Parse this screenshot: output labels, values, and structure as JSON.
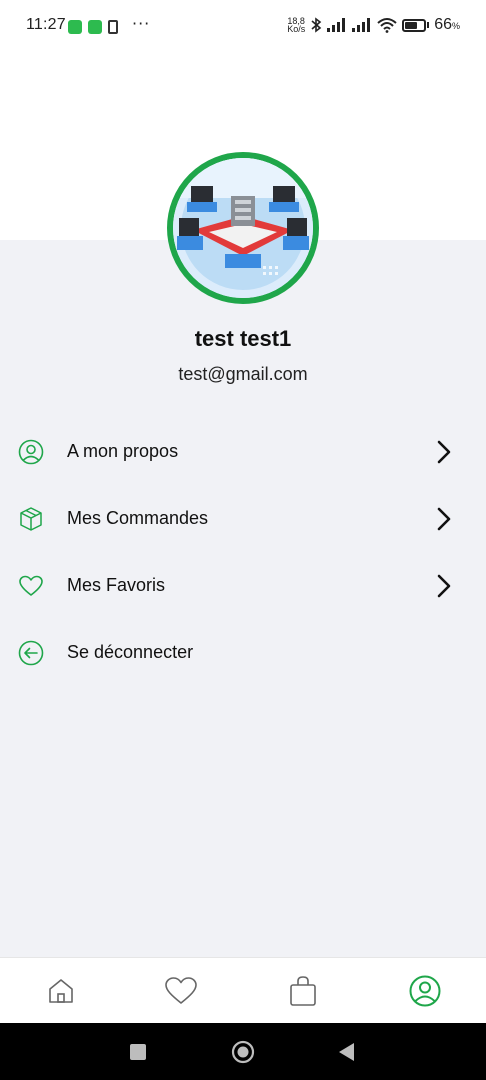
{
  "status_bar": {
    "time": "11:27",
    "dots": "···",
    "net_speed_value": "18,8",
    "net_speed_unit": "Ko/s",
    "battery_percent": "66",
    "battery_unit": "%"
  },
  "profile": {
    "name": "test test1",
    "email": "test@gmail.com"
  },
  "menu": {
    "items": [
      {
        "label": "A mon propos",
        "icon": "user-circle-icon",
        "has_chevron": true
      },
      {
        "label": "Mes Commandes",
        "icon": "package-icon",
        "has_chevron": true
      },
      {
        "label": "Mes Favoris",
        "icon": "heart-icon",
        "has_chevron": true
      },
      {
        "label": "Se déconnecter",
        "icon": "logout-icon",
        "has_chevron": false
      }
    ]
  },
  "bottom_nav": {
    "items": [
      "home-icon",
      "heart-icon",
      "shopping-bag-icon",
      "profile-icon"
    ],
    "active": "profile-icon"
  },
  "colors": {
    "accent": "#1fa64a",
    "background": "#f1f2f6",
    "text": "#111111"
  }
}
